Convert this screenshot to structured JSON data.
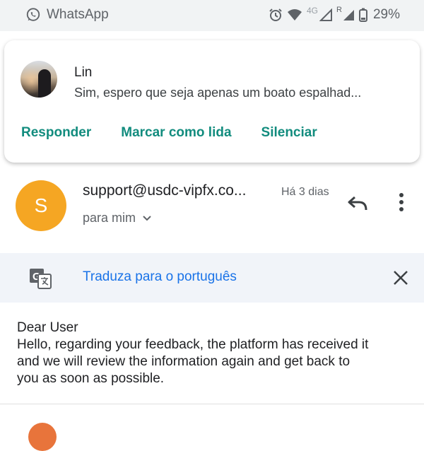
{
  "status_bar": {
    "app_name": "WhatsApp",
    "network_type": "4G",
    "roaming": "R",
    "battery_percent": "29%"
  },
  "notification": {
    "sender": "Lin",
    "message": "Sim, espero que seja apenas um boato espalhad...",
    "actions": [
      "Responder",
      "Marcar como lida",
      "Silenciar"
    ],
    "action_color": "#128c7e"
  },
  "email": {
    "avatar_letter": "S",
    "avatar_color": "#f5a623",
    "sender": "support@usdc-vipfx.co...",
    "date": "Há 3 dias",
    "recipient": "para mim",
    "translate_label": "Traduza para o português",
    "body_lines": [
      "Dear User",
      "Hello, regarding your feedback, the platform has received it",
      "and we will review the information again and get back to",
      "you as soon as possible."
    ]
  },
  "icons": [
    "whatsapp-icon",
    "alarm-icon",
    "wifi-icon",
    "signal-icon",
    "battery-icon",
    "reply-icon",
    "more-vert-icon",
    "translate-icon",
    "close-icon",
    "chevron-down-icon"
  ]
}
